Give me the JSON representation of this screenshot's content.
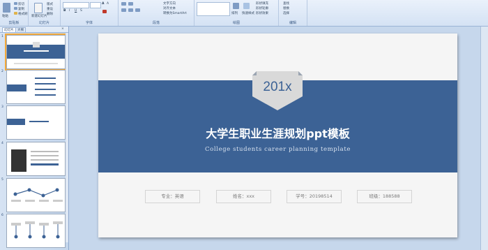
{
  "ribbon": {
    "groups": [
      {
        "label": "剪贴板",
        "items": [
          "粘贴",
          "剪切",
          "复制",
          "格式刷"
        ]
      },
      {
        "label": "幻灯片",
        "items": [
          "新建幻灯片",
          "版式",
          "重设",
          "删除"
        ]
      },
      {
        "label": "字体",
        "items": []
      },
      {
        "label": "段落",
        "items": [
          "文字方向",
          "对齐文本",
          "转换为SmartArt"
        ]
      },
      {
        "label": "绘图",
        "items": [
          "排列",
          "快速样式",
          "形状填充",
          "形状轮廓",
          "形状效果"
        ]
      },
      {
        "label": "编辑",
        "items": [
          "查找",
          "替换",
          "选择"
        ]
      }
    ]
  },
  "pane": {
    "tabs": [
      "幻灯片",
      "大纲"
    ],
    "slide_numbers": [
      "1",
      "2",
      "3",
      "4",
      "5",
      "6"
    ]
  },
  "slide": {
    "badge": "201x",
    "title": "大学生职业生涯规划ppt模板",
    "subtitle": "College students career planning template",
    "fields": [
      "专业：英语",
      "姓名：xxx",
      "学号：20198514",
      "班级：188588"
    ]
  },
  "colors": {
    "accent": "#3c6295",
    "ribbon": "#dbe7f6",
    "selected": "#f2a93b"
  }
}
